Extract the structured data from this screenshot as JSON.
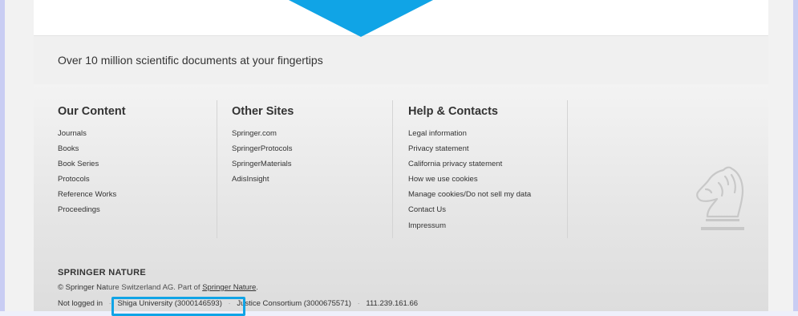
{
  "tagline": "Over 10 million scientific documents at your fingertips",
  "columns": [
    {
      "heading": "Our Content",
      "links": [
        "Journals",
        "Books",
        "Book Series",
        "Protocols",
        "Reference Works",
        "Proceedings"
      ]
    },
    {
      "heading": "Other Sites",
      "links": [
        "Springer.com",
        "SpringerProtocols",
        "SpringerMaterials",
        "AdisInsight"
      ]
    },
    {
      "heading": "Help & Contacts",
      "links": [
        "Legal information",
        "Privacy statement",
        "California privacy statement",
        "How we use cookies",
        "Manage cookies/Do not sell my data",
        "Contact Us",
        "Impressum"
      ]
    }
  ],
  "publisher": {
    "logo_text": "SPRINGER NATURE",
    "copyright_prefix": "© Springer Na",
    "copyright_hidden": "ture Switzerland AG. Part of",
    "copyright_link": "Springer Nature",
    "copyright_suffix": "."
  },
  "account": {
    "not_logged_in": "Not logged in",
    "institution_1": "Shiga University (3000146593)",
    "institution_2": "Justice Consortium (3000675571)",
    "ip": "111.239.161.66",
    "separator": "·"
  },
  "colors": {
    "highlight": "#10a4e6",
    "arrow": "#10a4e6"
  },
  "icons": {
    "logo_mark": "chess-knight-icon",
    "pointer": "down-arrow-annotation"
  }
}
